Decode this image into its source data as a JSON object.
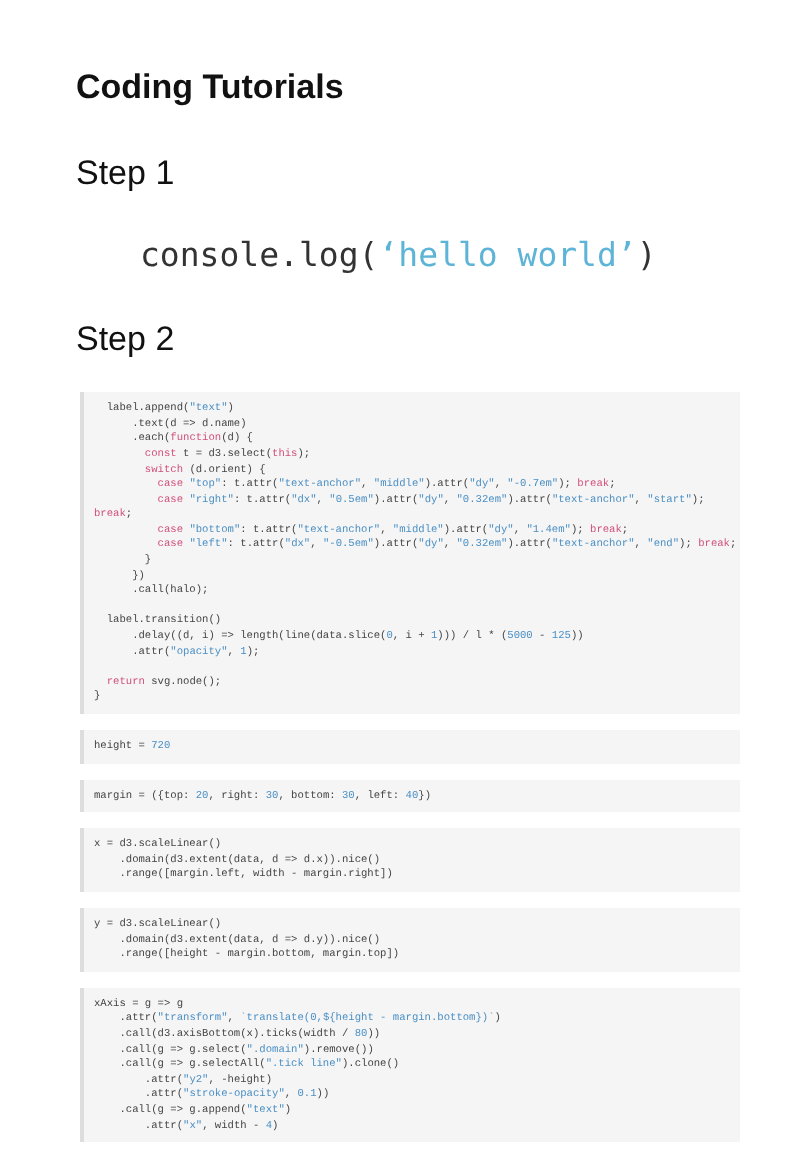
{
  "title": "Coding Tutorials",
  "steps": [
    {
      "label": "Step 1",
      "kind": "snippet",
      "code": [
        {
          "kind": "plain",
          "text": "console.log("
        },
        {
          "kind": "str",
          "text": "‘hello world’"
        },
        {
          "kind": "plain",
          "text": ")"
        }
      ]
    },
    {
      "label": "Step 2",
      "kind": "notebook",
      "cells": [
        {
          "groups": [
            [
              [
                {
                  "kind": "plain",
                  "text": "  label.append("
                },
                {
                  "kind": "str",
                  "text": "\"text\""
                },
                {
                  "kind": "plain",
                  "text": ")"
                }
              ],
              [
                {
                  "kind": "plain",
                  "text": "      .text(d => d.name)"
                }
              ],
              [
                {
                  "kind": "plain",
                  "text": "      .each("
                },
                {
                  "kind": "kw",
                  "text": "function"
                },
                {
                  "kind": "plain",
                  "text": "(d) {"
                }
              ],
              [
                {
                  "kind": "kw",
                  "text": "        const"
                },
                {
                  "kind": "plain",
                  "text": " t = d3.select("
                },
                {
                  "kind": "kw",
                  "text": "this"
                },
                {
                  "kind": "plain",
                  "text": ");"
                }
              ],
              [
                {
                  "kind": "kw",
                  "text": "        switch"
                },
                {
                  "kind": "plain",
                  "text": " (d.orient) {"
                }
              ],
              [
                {
                  "kind": "kw",
                  "text": "          case"
                },
                {
                  "kind": "str",
                  "text": " \"top\""
                },
                {
                  "kind": "plain",
                  "text": ": t.attr("
                },
                {
                  "kind": "str",
                  "text": "\"text-anchor\""
                },
                {
                  "kind": "plain",
                  "text": ", "
                },
                {
                  "kind": "str",
                  "text": "\"middle\""
                },
                {
                  "kind": "plain",
                  "text": ").attr("
                },
                {
                  "kind": "str",
                  "text": "\"dy\""
                },
                {
                  "kind": "plain",
                  "text": ", "
                },
                {
                  "kind": "str",
                  "text": "\"-0.7em\""
                },
                {
                  "kind": "plain",
                  "text": "); "
                },
                {
                  "kind": "kw",
                  "text": "break"
                },
                {
                  "kind": "plain",
                  "text": ";"
                }
              ],
              [
                {
                  "kind": "kw",
                  "text": "          case"
                },
                {
                  "kind": "str",
                  "text": " \"right\""
                },
                {
                  "kind": "plain",
                  "text": ": t.attr("
                },
                {
                  "kind": "str",
                  "text": "\"dx\""
                },
                {
                  "kind": "plain",
                  "text": ", "
                },
                {
                  "kind": "str",
                  "text": "\"0.5em\""
                },
                {
                  "kind": "plain",
                  "text": ").attr("
                },
                {
                  "kind": "str",
                  "text": "\"dy\""
                },
                {
                  "kind": "plain",
                  "text": ", "
                },
                {
                  "kind": "str",
                  "text": "\"0.32em\""
                },
                {
                  "kind": "plain",
                  "text": ").attr("
                },
                {
                  "kind": "str",
                  "text": "\"text-anchor\""
                },
                {
                  "kind": "plain",
                  "text": ", "
                },
                {
                  "kind": "str",
                  "text": "\"start\""
                },
                {
                  "kind": "plain",
                  "text": ");"
                }
              ],
              [
                {
                  "kind": "kw",
                  "text": "break"
                },
                {
                  "kind": "plain",
                  "text": ";"
                }
              ],
              [
                {
                  "kind": "kw",
                  "text": "          case"
                },
                {
                  "kind": "str",
                  "text": " \"bottom\""
                },
                {
                  "kind": "plain",
                  "text": ": t.attr("
                },
                {
                  "kind": "str",
                  "text": "\"text-anchor\""
                },
                {
                  "kind": "plain",
                  "text": ", "
                },
                {
                  "kind": "str",
                  "text": "\"middle\""
                },
                {
                  "kind": "plain",
                  "text": ").attr("
                },
                {
                  "kind": "str",
                  "text": "\"dy\""
                },
                {
                  "kind": "plain",
                  "text": ", "
                },
                {
                  "kind": "str",
                  "text": "\"1.4em\""
                },
                {
                  "kind": "plain",
                  "text": "); "
                },
                {
                  "kind": "kw",
                  "text": "break"
                },
                {
                  "kind": "plain",
                  "text": ";"
                }
              ],
              [
                {
                  "kind": "kw",
                  "text": "          case"
                },
                {
                  "kind": "str",
                  "text": " \"left\""
                },
                {
                  "kind": "plain",
                  "text": ": t.attr("
                },
                {
                  "kind": "str",
                  "text": "\"dx\""
                },
                {
                  "kind": "plain",
                  "text": ", "
                },
                {
                  "kind": "str",
                  "text": "\"-0.5em\""
                },
                {
                  "kind": "plain",
                  "text": ").attr("
                },
                {
                  "kind": "str",
                  "text": "\"dy\""
                },
                {
                  "kind": "plain",
                  "text": ", "
                },
                {
                  "kind": "str",
                  "text": "\"0.32em\""
                },
                {
                  "kind": "plain",
                  "text": ").attr("
                },
                {
                  "kind": "str",
                  "text": "\"text-anchor\""
                },
                {
                  "kind": "plain",
                  "text": ", "
                },
                {
                  "kind": "str",
                  "text": "\"end\""
                },
                {
                  "kind": "plain",
                  "text": "); "
                },
                {
                  "kind": "kw",
                  "text": "break"
                },
                {
                  "kind": "plain",
                  "text": ";"
                }
              ],
              [
                {
                  "kind": "plain",
                  "text": "        }"
                }
              ],
              [
                {
                  "kind": "plain",
                  "text": "      })"
                }
              ],
              [
                {
                  "kind": "plain",
                  "text": "      .call(halo);"
                }
              ]
            ],
            [
              [
                {
                  "kind": "plain",
                  "text": "  label.transition()"
                }
              ],
              [
                {
                  "kind": "plain",
                  "text": "      .delay((d, i) => length(line(data.slice("
                },
                {
                  "kind": "num",
                  "text": "0"
                },
                {
                  "kind": "plain",
                  "text": ", i + "
                },
                {
                  "kind": "num",
                  "text": "1"
                },
                {
                  "kind": "plain",
                  "text": "))) / l * ("
                },
                {
                  "kind": "num",
                  "text": "5000"
                },
                {
                  "kind": "plain",
                  "text": " - "
                },
                {
                  "kind": "num",
                  "text": "125"
                },
                {
                  "kind": "plain",
                  "text": "))"
                }
              ],
              [
                {
                  "kind": "plain",
                  "text": "      .attr("
                },
                {
                  "kind": "str",
                  "text": "\"opacity\""
                },
                {
                  "kind": "plain",
                  "text": ", "
                },
                {
                  "kind": "num",
                  "text": "1"
                },
                {
                  "kind": "plain",
                  "text": ");"
                }
              ]
            ],
            [
              [
                {
                  "kind": "kw",
                  "text": "  return"
                },
                {
                  "kind": "plain",
                  "text": " svg.node();"
                }
              ],
              [
                {
                  "kind": "plain",
                  "text": "}"
                }
              ]
            ]
          ]
        },
        {
          "groups": [
            [
              [
                {
                  "kind": "plain",
                  "text": "height = "
                },
                {
                  "kind": "num",
                  "text": "720"
                }
              ]
            ]
          ]
        },
        {
          "groups": [
            [
              [
                {
                  "kind": "plain",
                  "text": "margin = ({top: "
                },
                {
                  "kind": "num",
                  "text": "20"
                },
                {
                  "kind": "plain",
                  "text": ", right: "
                },
                {
                  "kind": "num",
                  "text": "30"
                },
                {
                  "kind": "plain",
                  "text": ", bottom: "
                },
                {
                  "kind": "num",
                  "text": "30"
                },
                {
                  "kind": "plain",
                  "text": ", left: "
                },
                {
                  "kind": "num",
                  "text": "40"
                },
                {
                  "kind": "plain",
                  "text": "})"
                }
              ]
            ]
          ]
        },
        {
          "groups": [
            [
              [
                {
                  "kind": "plain",
                  "text": "x = d3.scaleLinear()"
                }
              ],
              [
                {
                  "kind": "plain",
                  "text": "    .domain(d3.extent(data, d => d.x)).nice()"
                }
              ],
              [
                {
                  "kind": "plain",
                  "text": "    .range([margin.left, width - margin.right])"
                }
              ]
            ]
          ]
        },
        {
          "groups": [
            [
              [
                {
                  "kind": "plain",
                  "text": "y = d3.scaleLinear()"
                }
              ],
              [
                {
                  "kind": "plain",
                  "text": "    .domain(d3.extent(data, d => d.y)).nice()"
                }
              ],
              [
                {
                  "kind": "plain",
                  "text": "    .range([height - margin.bottom, margin.top])"
                }
              ]
            ]
          ]
        },
        {
          "groups": [
            [
              [
                {
                  "kind": "plain",
                  "text": "xAxis = g => g"
                }
              ],
              [
                {
                  "kind": "plain",
                  "text": "    .attr("
                },
                {
                  "kind": "str",
                  "text": "\"transform\""
                },
                {
                  "kind": "plain",
                  "text": ", "
                },
                {
                  "kind": "str",
                  "text": "`translate(0,${height - margin.bottom})`"
                },
                {
                  "kind": "plain",
                  "text": ")"
                }
              ],
              [
                {
                  "kind": "plain",
                  "text": "    .call(d3.axisBottom(x).ticks(width / "
                },
                {
                  "kind": "num",
                  "text": "80"
                },
                {
                  "kind": "plain",
                  "text": "))"
                }
              ],
              [
                {
                  "kind": "plain",
                  "text": "    .call(g => g.select("
                },
                {
                  "kind": "str",
                  "text": "\".domain\""
                },
                {
                  "kind": "plain",
                  "text": ").remove())"
                }
              ],
              [
                {
                  "kind": "plain",
                  "text": "    .call(g => g.selectAll("
                },
                {
                  "kind": "str",
                  "text": "\".tick line\""
                },
                {
                  "kind": "plain",
                  "text": ").clone()"
                }
              ],
              [
                {
                  "kind": "plain",
                  "text": "        .attr("
                },
                {
                  "kind": "str",
                  "text": "\"y2\""
                },
                {
                  "kind": "plain",
                  "text": ", -height)"
                }
              ],
              [
                {
                  "kind": "plain",
                  "text": "        .attr("
                },
                {
                  "kind": "str",
                  "text": "\"stroke-opacity\""
                },
                {
                  "kind": "plain",
                  "text": ", "
                },
                {
                  "kind": "num",
                  "text": "0.1"
                },
                {
                  "kind": "plain",
                  "text": "))"
                }
              ],
              [
                {
                  "kind": "plain",
                  "text": "    .call(g => g.append("
                },
                {
                  "kind": "str",
                  "text": "\"text\""
                },
                {
                  "kind": "plain",
                  "text": ")"
                }
              ],
              [
                {
                  "kind": "plain",
                  "text": "        .attr("
                },
                {
                  "kind": "str",
                  "text": "\"x\""
                },
                {
                  "kind": "plain",
                  "text": ", width - "
                },
                {
                  "kind": "num",
                  "text": "4"
                },
                {
                  "kind": "plain",
                  "text": ")"
                }
              ]
            ]
          ]
        }
      ]
    }
  ]
}
